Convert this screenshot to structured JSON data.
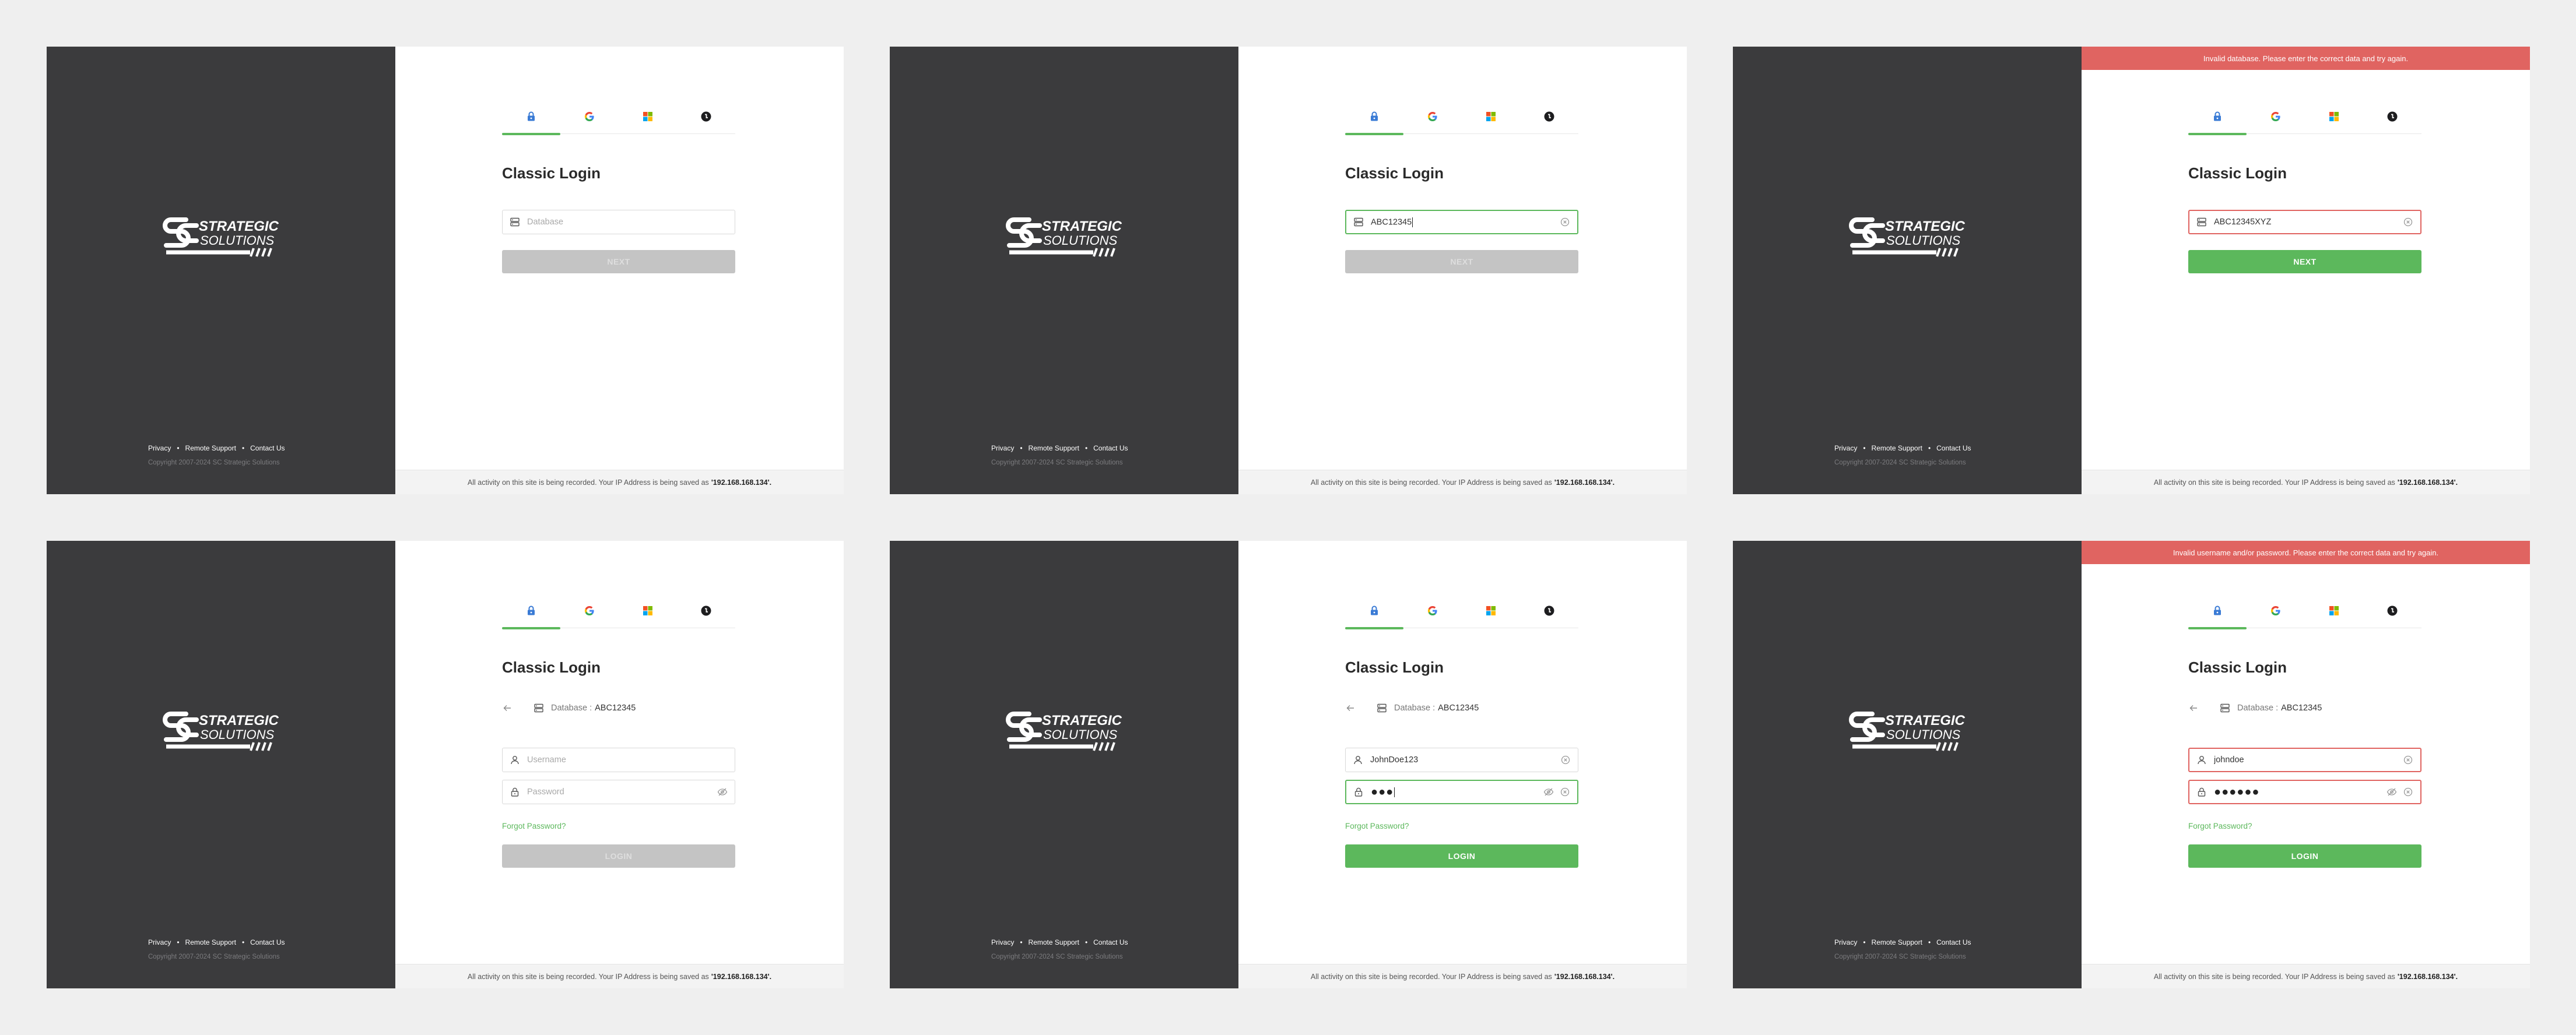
{
  "brand": {
    "line1": "STRATEGIC",
    "line2": "SOLUTIONS"
  },
  "footer_links": {
    "privacy": "Privacy",
    "remote_support": "Remote Support",
    "contact_us": "Contact Us",
    "separator": "•"
  },
  "copyright": "Copyright 2007-2024 SC Strategic Solutions",
  "notice": {
    "text": "All activity on this site is being recorded. Your IP Address is being saved as",
    "ip": "'192.168.168.134'."
  },
  "title": "Classic Login",
  "placeholders": {
    "database": "Database",
    "username": "Username",
    "password": "Password"
  },
  "database_label": "Database :",
  "forgot_password": "Forgot Password?",
  "buttons": {
    "next": "NEXT",
    "login": "LOGIN"
  },
  "colors": {
    "accent": "#5cb85c",
    "error": "#e06461",
    "dark_panel": "#3b3b3d",
    "disabled": "#c4c4c4"
  },
  "icons": {
    "tab1": "lock-icon",
    "tab2": "google-icon",
    "tab3": "microsoft-icon",
    "tab4": "dark-circle-icon"
  },
  "screens": [
    {
      "database_value": "",
      "next_state": "disabled"
    },
    {
      "database_value": "ABC12345",
      "next_state": "disabled"
    },
    {
      "error": "Invalid database. Please enter the correct data and try again.",
      "database_value": "ABC12345XYZ",
      "next_state": "enabled"
    },
    {
      "database_value": "ABC12345",
      "username_value": "",
      "password_dots": "",
      "login_state": "disabled"
    },
    {
      "database_value": "ABC12345",
      "username_value": "JohnDoe123",
      "password_dots": "●●●",
      "login_state": "enabled"
    },
    {
      "error": "Invalid username and/or password. Please enter the correct data and try again.",
      "database_value": "ABC12345",
      "username_value": "johndoe",
      "password_dots": "●●●●●●",
      "login_state": "enabled"
    }
  ]
}
